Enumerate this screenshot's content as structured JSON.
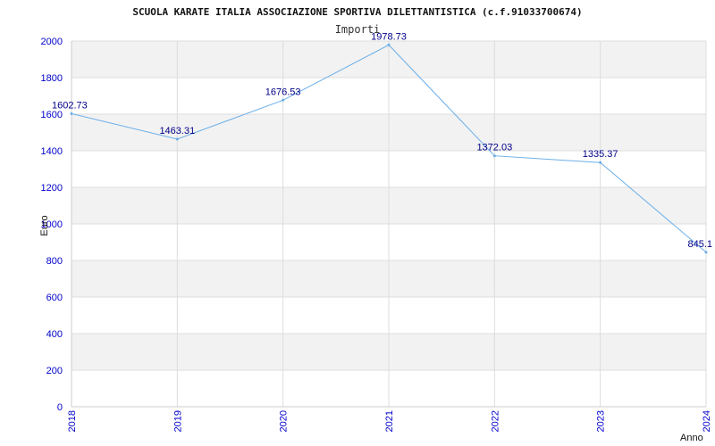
{
  "chart_data": {
    "type": "line",
    "title": "SCUOLA KARATE ITALIA ASSOCIAZIONE SPORTIVA DILETTANTISTICA (c.f.91033700674)",
    "subtitle": "Importi",
    "xlabel": "Anno",
    "ylabel": "Euro",
    "categories": [
      "2018",
      "2019",
      "2020",
      "2021",
      "2022",
      "2023",
      "2024"
    ],
    "values": [
      1602.73,
      1463.31,
      1676.53,
      1978.73,
      1372.03,
      1335.37,
      845.1
    ],
    "value_labels": [
      "1602.73",
      "1463.31",
      "1676.53",
      "1978.73",
      "1372.03",
      "1335.37",
      "845.1"
    ],
    "ylim": [
      0,
      2000
    ],
    "yticks": [
      0,
      200,
      400,
      600,
      800,
      1000,
      1200,
      1400,
      1600,
      1800,
      2000
    ],
    "grid": true,
    "band_colors": [
      "#ffffff",
      "#f2f2f2"
    ],
    "line_color": "#6aaee8",
    "tick_color": "#0000cc",
    "label_color": "#000088"
  }
}
